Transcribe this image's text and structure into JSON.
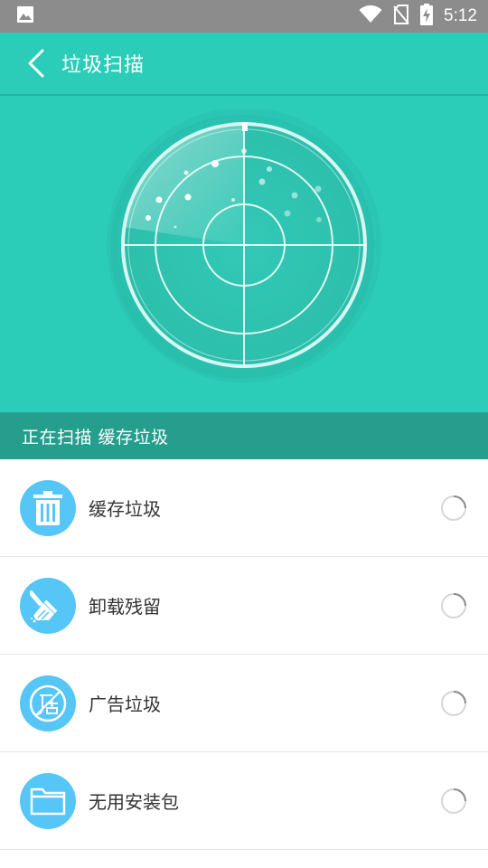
{
  "status_bar": {
    "time": "5:12",
    "icons": [
      "image-icon",
      "wifi-icon",
      "no-sim-icon",
      "battery-charging-icon"
    ]
  },
  "app_bar": {
    "title": "垃圾扫描",
    "back_icon": "chevron-left-icon"
  },
  "scan_status": {
    "text": "正在扫描 缓存垃圾"
  },
  "items": [
    {
      "label": "缓存垃圾",
      "icon": "trash-icon"
    },
    {
      "label": "卸载残留",
      "icon": "broom-icon"
    },
    {
      "label": "广告垃圾",
      "icon": "ad-icon"
    },
    {
      "label": "无用安装包",
      "icon": "folder-icon"
    }
  ],
  "colors": {
    "primary": "#2bcdb9",
    "primary_dark": "#259e8e",
    "icon_bg": "#56c6f7",
    "status_bar": "#8c8c8c"
  }
}
